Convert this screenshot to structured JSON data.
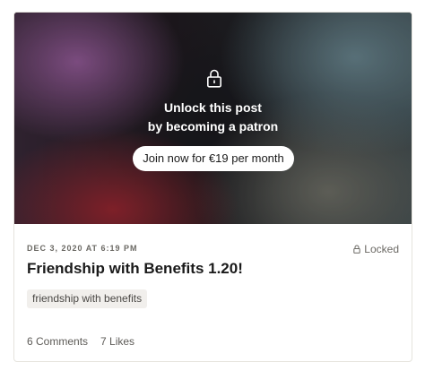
{
  "post": {
    "lock_overlay": {
      "line1": "Unlock this post",
      "line2": "by becoming a patron",
      "join_button_label": "Join now for €19 per month"
    },
    "date": "DEC 3, 2020 AT 6:19 PM",
    "status": "Locked",
    "title": "Friendship with Benefits 1.20!",
    "tags": [
      "friendship with benefits"
    ],
    "stats": {
      "comments": "6 Comments",
      "likes": "7 Likes"
    }
  },
  "icons": {
    "overlay_lock": "lock-icon",
    "locked_badge": "lock-icon"
  },
  "colors": {
    "card_border": "#e5e3dd",
    "button_bg": "#ffffff",
    "text_primary": "#1a1a1a",
    "text_muted": "#6b6964",
    "tag_bg": "#f1efec"
  }
}
